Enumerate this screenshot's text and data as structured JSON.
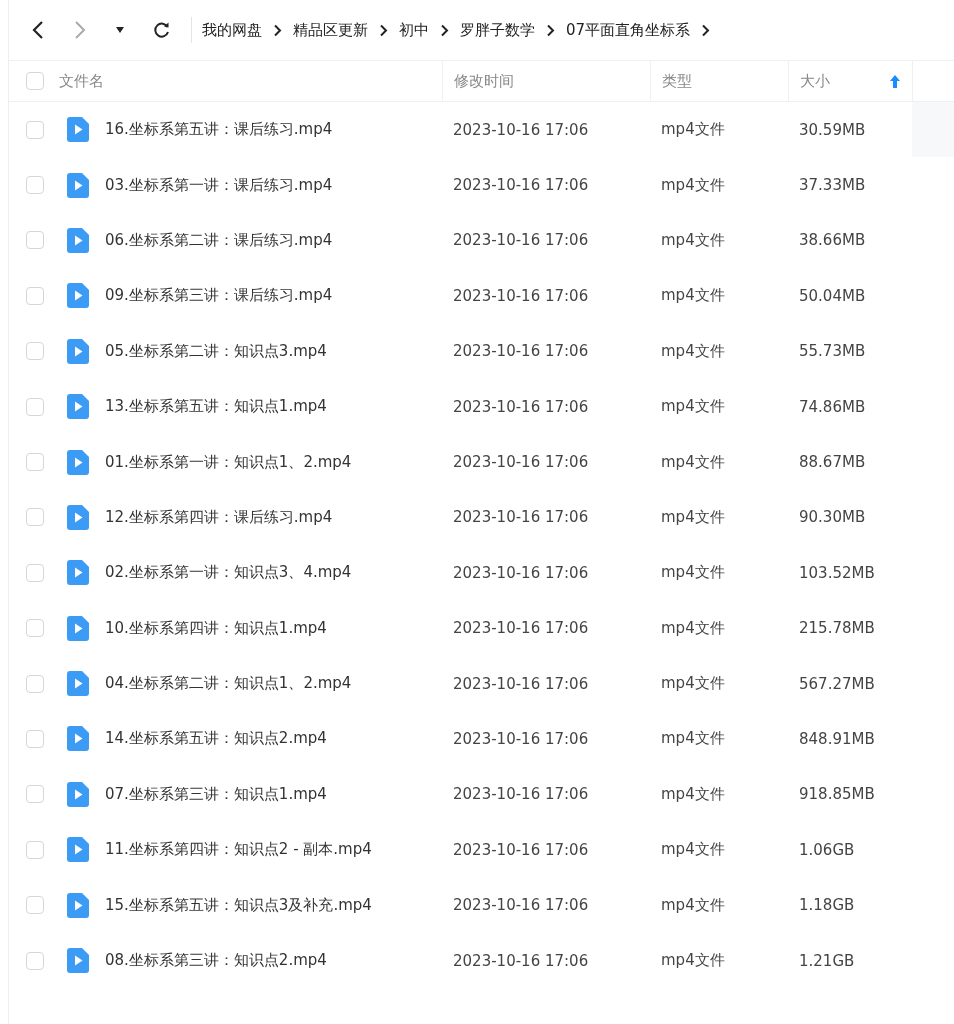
{
  "nav": [
    {
      "kind": "back",
      "disabled": false
    },
    {
      "kind": "forward",
      "disabled": true
    },
    {
      "kind": "dropdown",
      "disabled": false
    },
    {
      "kind": "refresh",
      "disabled": false
    }
  ],
  "breadcrumb": [
    "我的网盘",
    "精品区更新",
    "初中",
    "罗胖子数学",
    "07平面直角坐标系"
  ],
  "table": {
    "select_all": {
      "checked": false
    },
    "columns": [
      {
        "label": "文件名"
      },
      {
        "label": "修改时间"
      },
      {
        "label": "类型"
      },
      {
        "label": "大小",
        "sorted": true
      }
    ],
    "rows": [
      {
        "name": "16.坐标系第五讲：课后练习.mp4",
        "time": "2023-10-16 17:06",
        "type": "mp4文件",
        "size": "30.59MB",
        "checked": false
      },
      {
        "name": "03.坐标系第一讲：课后练习.mp4",
        "time": "2023-10-16 17:06",
        "type": "mp4文件",
        "size": "37.33MB",
        "checked": false
      },
      {
        "name": "06.坐标系第二讲：课后练习.mp4",
        "time": "2023-10-16 17:06",
        "type": "mp4文件",
        "size": "38.66MB",
        "checked": false
      },
      {
        "name": "09.坐标系第三讲：课后练习.mp4",
        "time": "2023-10-16 17:06",
        "type": "mp4文件",
        "size": "50.04MB",
        "checked": false
      },
      {
        "name": "05.坐标系第二讲：知识点3.mp4",
        "time": "2023-10-16 17:06",
        "type": "mp4文件",
        "size": "55.73MB",
        "checked": false
      },
      {
        "name": "13.坐标系第五讲：知识点1.mp4",
        "time": "2023-10-16 17:06",
        "type": "mp4文件",
        "size": "74.86MB",
        "checked": false
      },
      {
        "name": "01.坐标系第一讲：知识点1、2.mp4",
        "time": "2023-10-16 17:06",
        "type": "mp4文件",
        "size": "88.67MB",
        "checked": false
      },
      {
        "name": "12.坐标系第四讲：课后练习.mp4",
        "time": "2023-10-16 17:06",
        "type": "mp4文件",
        "size": "90.30MB",
        "checked": false
      },
      {
        "name": "02.坐标系第一讲：知识点3、4.mp4",
        "time": "2023-10-16 17:06",
        "type": "mp4文件",
        "size": "103.52MB",
        "checked": false
      },
      {
        "name": "10.坐标系第四讲：知识点1.mp4",
        "time": "2023-10-16 17:06",
        "type": "mp4文件",
        "size": "215.78MB",
        "checked": false
      },
      {
        "name": "04.坐标系第二讲：知识点1、2.mp4",
        "time": "2023-10-16 17:06",
        "type": "mp4文件",
        "size": "567.27MB",
        "checked": false
      },
      {
        "name": "14.坐标系第五讲：知识点2.mp4",
        "time": "2023-10-16 17:06",
        "type": "mp4文件",
        "size": "848.91MB",
        "checked": false
      },
      {
        "name": "07.坐标系第三讲：知识点1.mp4",
        "time": "2023-10-16 17:06",
        "type": "mp4文件",
        "size": "918.85MB",
        "checked": false
      },
      {
        "name": "11.坐标系第四讲：知识点2 - 副本.mp4",
        "time": "2023-10-16 17:06",
        "type": "mp4文件",
        "size": "1.06GB",
        "checked": false
      },
      {
        "name": "15.坐标系第五讲：知识点3及补充.mp4",
        "time": "2023-10-16 17:06",
        "type": "mp4文件",
        "size": "1.18GB",
        "checked": false
      },
      {
        "name": "08.坐标系第三讲：知识点2.mp4",
        "time": "2023-10-16 17:06",
        "type": "mp4文件",
        "size": "1.21GB",
        "checked": false
      }
    ]
  }
}
